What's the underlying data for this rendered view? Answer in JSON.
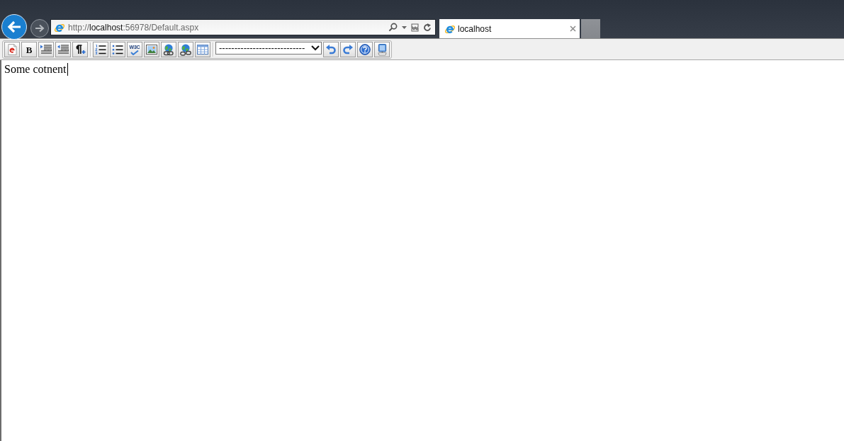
{
  "browser": {
    "navigation": {
      "back": {
        "disabled": false
      },
      "forward": {
        "disabled": true
      }
    },
    "address": {
      "scheme": "http://",
      "host": "localhost",
      "path": ":56978/Default.aspx"
    },
    "tabs": [
      {
        "title": "localhost",
        "selected": true
      }
    ]
  },
  "toolbar": {
    "items": [
      {
        "kind": "html"
      },
      {
        "kind": "bold",
        "label": "B"
      },
      {
        "kind": "indent"
      },
      {
        "kind": "outdent"
      },
      {
        "kind": "paragraph"
      },
      {
        "kind": "separator"
      },
      {
        "kind": "numbered"
      },
      {
        "kind": "bullets"
      },
      {
        "kind": "validate",
        "label": "W3C"
      },
      {
        "kind": "image"
      },
      {
        "kind": "link"
      },
      {
        "kind": "unlink"
      },
      {
        "kind": "table"
      },
      {
        "kind": "separator"
      },
      {
        "kind": "select",
        "value": "----------------------------"
      },
      {
        "kind": "undo"
      },
      {
        "kind": "redo"
      },
      {
        "kind": "help"
      },
      {
        "kind": "preview"
      }
    ]
  },
  "editor": {
    "content": "Some cotnent",
    "focused": true
  }
}
